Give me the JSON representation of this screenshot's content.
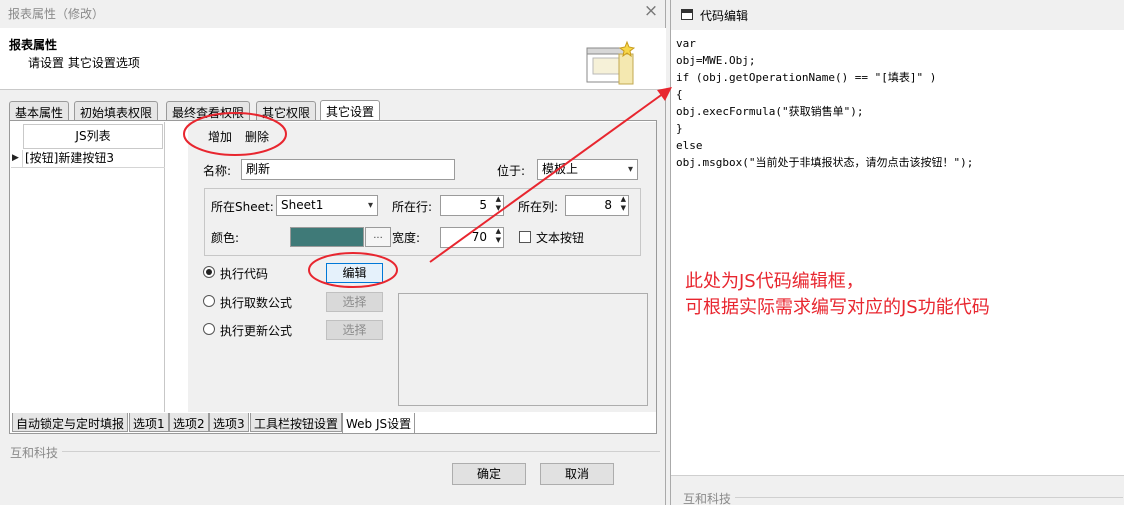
{
  "dialog": {
    "title": "报表属性（修改）",
    "close_glyph": "×",
    "header_title": "报表属性",
    "header_subtitle": "请设置 其它设置选项",
    "top_tabs": [
      "基本属性",
      "初始填表权限",
      "最终查看权限",
      "其它权限",
      "其它设置"
    ],
    "active_top_tab": "其它设置",
    "js_list": {
      "header": "JS列表",
      "rows": [
        "[按钮]新建按钮3"
      ],
      "row_arrow": "▶"
    },
    "actions": {
      "add": "增加",
      "delete": "删除"
    },
    "form": {
      "name_label": "名称:",
      "name_value": "刷新",
      "position_label": "位于:",
      "position_value": "模板上",
      "sheet_label": "所在Sheet:",
      "sheet_value": "Sheet1",
      "row_label": "所在行:",
      "row_value": "5",
      "col_label": "所在列:",
      "col_value": "8",
      "color_label": "颜色:",
      "color_value": "#3f7a78",
      "color_button": "...",
      "width_label": "宽度:",
      "width_value": "70",
      "text_button_label": "文本按钮",
      "text_button_checked": false
    },
    "exec": {
      "run_code_label": "执行代码",
      "run_code_selected": true,
      "edit_button": "编辑",
      "fetch_formula_label": "执行取数公式",
      "update_formula_label": "执行更新公式",
      "select_button": "选择"
    },
    "bottom_tabs": [
      "自动锁定与定时填报",
      "选项1",
      "选项2",
      "选项3",
      "工具栏按钮设置",
      "Web JS设置"
    ],
    "active_bottom_tab": "Web JS设置",
    "brand": "互和科技",
    "ok": "确定",
    "cancel": "取消"
  },
  "editor": {
    "title": "代码编辑",
    "code_lines": [
      "var",
      "obj=MWE.Obj;",
      "if (obj.getOperationName() == \"[填表]\" )",
      "{",
      "obj.execFormula(\"获取销售单\");",
      "}",
      "else",
      "obj.msgbox(\"当前处于非填报状态，请勿点击该按钮！\");"
    ],
    "annotation_line1": "此处为JS代码编辑框，",
    "annotation_line2": "可根据实际需求编写对应的JS功能代码",
    "brand": "互和科技"
  },
  "colors": {
    "annotation_red": "#e8262f",
    "color_swatch": "#3f7a78",
    "focus_blue": "#0078d7"
  }
}
